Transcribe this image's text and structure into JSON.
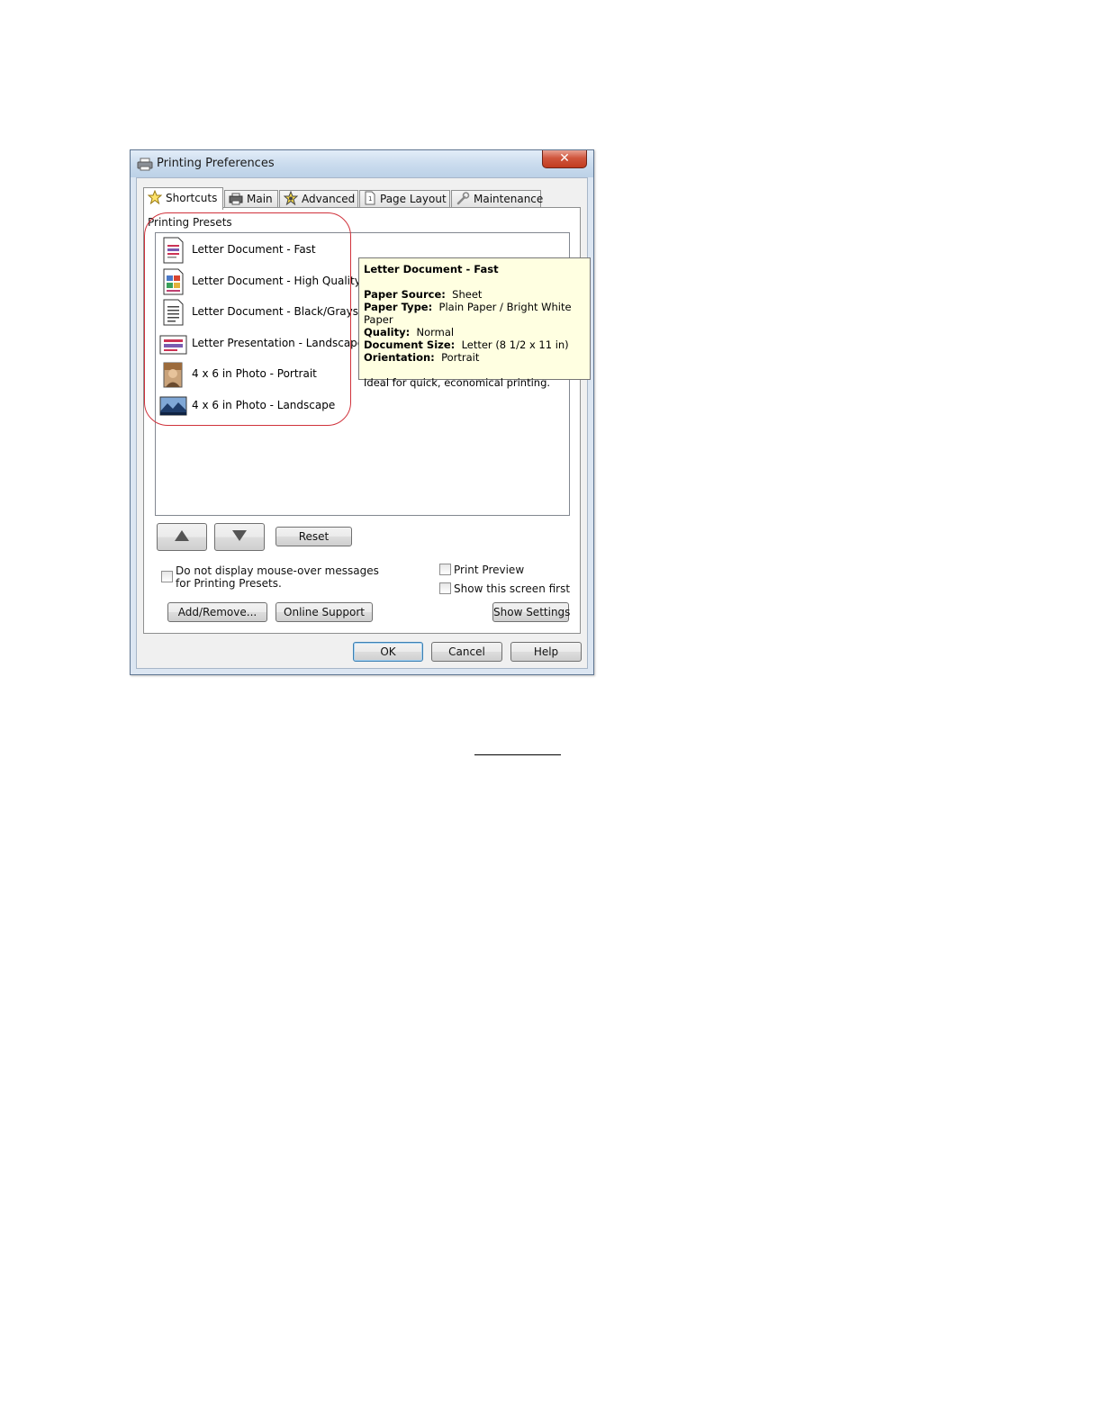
{
  "window": {
    "title": "Printing Preferences",
    "close_glyph": "✕"
  },
  "tabs": [
    {
      "label": "Shortcuts",
      "icon": "star-icon"
    },
    {
      "label": "Main",
      "icon": "printer-icon"
    },
    {
      "label": "Advanced",
      "icon": "advanced-icon"
    },
    {
      "label": "Page Layout",
      "icon": "page-layout-icon"
    },
    {
      "label": "Maintenance",
      "icon": "wrench-icon"
    }
  ],
  "presets": {
    "group_label": "Printing Presets",
    "items": [
      {
        "label": "Letter Document - Fast",
        "icon": "document-fast-icon"
      },
      {
        "label": "Letter Document - High Quality",
        "icon": "document-high-quality-icon"
      },
      {
        "label": "Letter Document - Black/Grayscale",
        "icon": "document-grayscale-icon"
      },
      {
        "label": "Letter Presentation - Landscape",
        "icon": "presentation-landscape-icon"
      },
      {
        "label": "4 x 6 in Photo - Portrait",
        "icon": "photo-portrait-icon"
      },
      {
        "label": "4 x 6 in Photo - Landscape",
        "icon": "photo-landscape-icon"
      }
    ]
  },
  "tooltip": {
    "title": "Letter Document - Fast",
    "rows": [
      {
        "key": "Paper Source:",
        "value": "Sheet"
      },
      {
        "key": "Paper Type:",
        "value": "Plain Paper / Bright White Paper"
      },
      {
        "key": "Quality:",
        "value": "Normal"
      },
      {
        "key": "Document Size:",
        "value": "Letter (8 1/2 x 11 in)"
      },
      {
        "key": "Orientation:",
        "value": "Portrait"
      }
    ],
    "description": "Ideal for quick, economical printing."
  },
  "controls": {
    "reset": "Reset",
    "mouseover_line1": "Do not display mouse-over messages",
    "mouseover_line2": "for Printing Presets.",
    "print_preview": "Print Preview",
    "show_screen_first": "Show this screen first",
    "add_remove": "Add/Remove...",
    "online_support": "Online Support",
    "show_settings": "Show Settings"
  },
  "footer": {
    "ok": "OK",
    "cancel": "Cancel",
    "help": "Help"
  },
  "colors": {
    "highlight": "#d0323b",
    "tooltip_bg": "#ffffe1",
    "window_frame": "#dce6f2"
  }
}
